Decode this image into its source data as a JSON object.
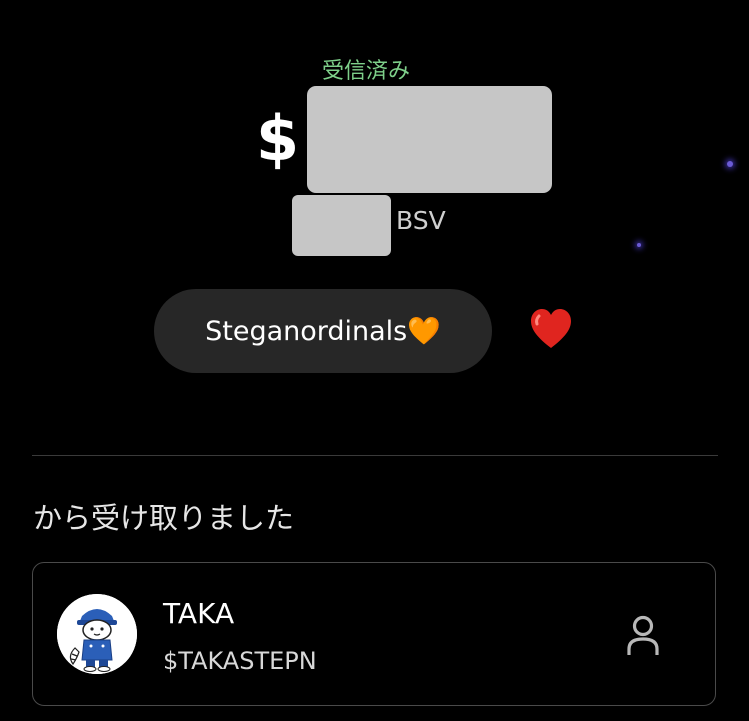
{
  "transaction": {
    "status": "受信済み",
    "currency_symbol": "$",
    "unit": "BSV",
    "app_name": "Steganordinals🧡"
  },
  "section": {
    "received_from_label": "から受け取りました"
  },
  "sender": {
    "name": "TAKA",
    "handle": "$TAKASTEPN"
  },
  "icons": {
    "reaction": "red-heart-icon",
    "profile": "person-icon",
    "avatar": "cartoon-avatar"
  },
  "colors": {
    "status": "#7ed08a",
    "pill": "#272727",
    "heart": "#e0251f"
  }
}
